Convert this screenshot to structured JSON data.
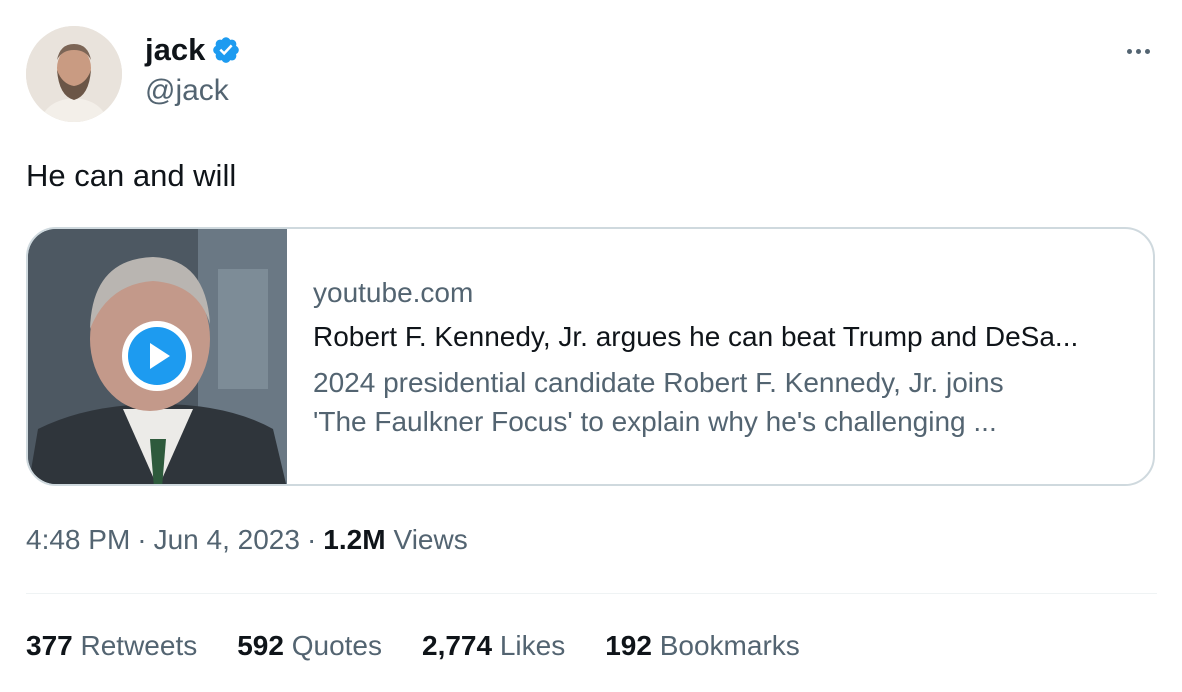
{
  "author": {
    "name": "jack",
    "handle": "@jack",
    "verified_color": "#1d9bf0"
  },
  "tweet": {
    "text": "He can and will"
  },
  "link_card": {
    "domain": "youtube.com",
    "title": "Robert F. Kennedy, Jr. argues he can beat Trump and DeSa...",
    "description_line1": "2024 presidential candidate Robert F. Kennedy, Jr. joins",
    "description_line2": "'The Faulkner Focus' to explain why he's challenging ...",
    "play_icon": "play-icon"
  },
  "meta": {
    "time": "4:48 PM",
    "sep1": "·",
    "date": "Jun 4, 2023",
    "sep2": "·",
    "views_count": "1.2M",
    "views_label": "Views"
  },
  "stats": {
    "retweets_count": "377",
    "retweets_label": "Retweets",
    "quotes_count": "592",
    "quotes_label": "Quotes",
    "likes_count": "2,774",
    "likes_label": "Likes",
    "bookmarks_count": "192",
    "bookmarks_label": "Bookmarks"
  },
  "colors": {
    "text_primary": "#0f1419",
    "text_secondary": "#536471",
    "border": "#cfd9de",
    "accent": "#1d9bf0"
  }
}
